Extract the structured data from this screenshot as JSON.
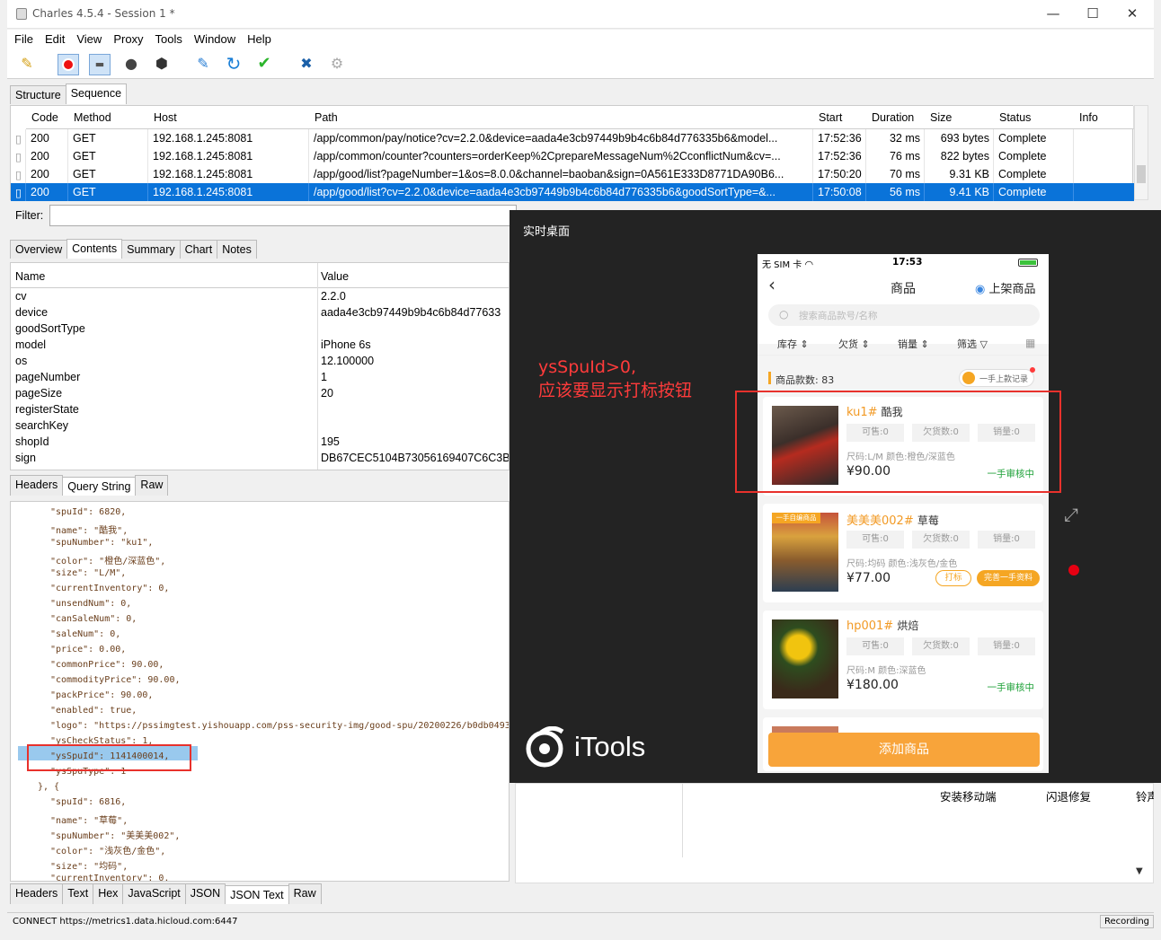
{
  "window": {
    "title": "Charles 4.5.4 - Session 1 *"
  },
  "menu": [
    "File",
    "Edit",
    "View",
    "Proxy",
    "Tools",
    "Window",
    "Help"
  ],
  "top_tabs": [
    "Structure",
    "Sequence"
  ],
  "seq": {
    "headers": [
      "Code",
      "Method",
      "Host",
      "Path",
      "Start",
      "Duration",
      "Size",
      "Status",
      "Info"
    ],
    "rows": [
      {
        "code": "200",
        "method": "GET",
        "host": "192.168.1.245:8081",
        "path": "/app/common/pay/notice?cv=2.2.0&device=aada4e3cb97449b9b4c6b84d776335b6&model...",
        "start": "17:52:36",
        "duration": "32 ms",
        "size": "693 bytes",
        "status": "Complete"
      },
      {
        "code": "200",
        "method": "GET",
        "host": "192.168.1.245:8081",
        "path": "/app/common/counter?counters=orderKeep%2CprepareMessageNum%2CconflictNum&cv=...",
        "start": "17:52:36",
        "duration": "76 ms",
        "size": "822 bytes",
        "status": "Complete"
      },
      {
        "code": "200",
        "method": "GET",
        "host": "192.168.1.245:8081",
        "path": "/app/good/list?pageNumber=1&os=8.0.0&channel=baoban&sign=0A561E333D8771DA90B6...",
        "start": "17:50:20",
        "duration": "70 ms",
        "size": "9.31 KB",
        "status": "Complete"
      },
      {
        "code": "200",
        "method": "GET",
        "host": "192.168.1.245:8081",
        "path": "/app/good/list?cv=2.2.0&device=aada4e3cb97449b9b4c6b84d776335b6&goodSortType=&...",
        "start": "17:50:08",
        "duration": "56 ms",
        "size": "9.41 KB",
        "status": "Complete"
      }
    ]
  },
  "filter_label": "Filter:",
  "detail_tabs": [
    "Overview",
    "Contents",
    "Summary",
    "Chart",
    "Notes"
  ],
  "params": {
    "header_name": "Name",
    "header_value": "Value",
    "rows": [
      {
        "n": "cv",
        "v": "2.2.0"
      },
      {
        "n": "device",
        "v": "aada4e3cb97449b9b4c6b84d77633"
      },
      {
        "n": "goodSortType",
        "v": ""
      },
      {
        "n": "model",
        "v": "iPhone 6s"
      },
      {
        "n": "os",
        "v": "12.100000"
      },
      {
        "n": "pageNumber",
        "v": "1"
      },
      {
        "n": "pageSize",
        "v": "20"
      },
      {
        "n": "registerState",
        "v": ""
      },
      {
        "n": "searchKey",
        "v": ""
      },
      {
        "n": "shopId",
        "v": "195"
      },
      {
        "n": "sign",
        "v": "DB67CEC5104B73056169407C6C3B5"
      }
    ]
  },
  "request_tabs": [
    "Headers",
    "Query String",
    "Raw"
  ],
  "json_lines": [
    "\"spuId\": 6820,",
    "\"name\": \"酷我\",",
    "\"spuNumber\": \"ku1\",",
    "\"color\": \"橙色/深蓝色\",",
    "\"size\": \"L/M\",",
    "\"currentInventory\": 0,",
    "\"unsendNum\": 0,",
    "\"canSaleNum\": 0,",
    "\"saleNum\": 0,",
    "\"price\": 0.00,",
    "\"commonPrice\": 90.00,",
    "\"commodityPrice\": 90.00,",
    "\"packPrice\": 90.00,",
    "\"enabled\": true,",
    "\"logo\": \"https://pssimgtest.yishouapp.com/pss-security-img/good-spu/20200226/b0db0493",
    "\"ysCheckStatus\": 1,",
    "\"ysSpuId\": 1141400014,",
    "\"ysSpuType\": 1",
    "}, {",
    "\"spuId\": 6816,",
    "\"name\": \"草莓\",",
    "\"spuNumber\": \"美美美002\",",
    "\"color\": \"浅灰色/金色\",",
    "\"size\": \"均码\",",
    "\"currentInventory\": 0,"
  ],
  "response_tabs": [
    "Headers",
    "Text",
    "Hex",
    "JavaScript",
    "JSON",
    "JSON Text",
    "Raw"
  ],
  "status": {
    "left": "CONNECT https://metrics1.data.hicloud.com:6447",
    "right": "Recording"
  },
  "bg_labels": [
    "安装移动端",
    "闪退修复",
    "铃声"
  ],
  "mirror": {
    "title": "实时桌面",
    "brand": "iTools"
  },
  "annotation": {
    "line1": "ysSpuId>0,",
    "line2": "应该要显示打标按钮"
  },
  "phone": {
    "carrier": "无 SIM 卡",
    "time": "17:53",
    "title": "商品",
    "action": "上架商品",
    "search_placeholder": "搜索商品款号/名称",
    "filters": [
      "库存",
      "欠货",
      "销量",
      "筛选"
    ],
    "count_label": "商品款数: 83",
    "record_btn": "一手上款记录",
    "products": [
      {
        "code": "ku1#",
        "name": "酷我",
        "sale": "可售:0",
        "owe": "欠货数:0",
        "sold": "销量:0",
        "attr": "尺码:L/M  颜色:橙色/深蓝色",
        "price": "¥90.00",
        "state": "一手审核中"
      },
      {
        "code": "美美美002#",
        "name": "草莓",
        "sale": "可售:0",
        "owe": "欠货数:0",
        "sold": "销量:0",
        "attr": "尺码:均码  颜色:浅灰色/金色",
        "price": "¥77.00",
        "btn1": "打标",
        "btn2": "完善一手资料",
        "badge": "一手自编商品"
      },
      {
        "code": "hp001#",
        "name": "烘焙",
        "sale": "可售:0",
        "owe": "欠货数:0",
        "sold": "销量:0",
        "attr": "尺码:M  颜色:深蓝色",
        "price": "¥180.00",
        "state": "一手审核中"
      }
    ],
    "add_btn": "添加商品"
  }
}
